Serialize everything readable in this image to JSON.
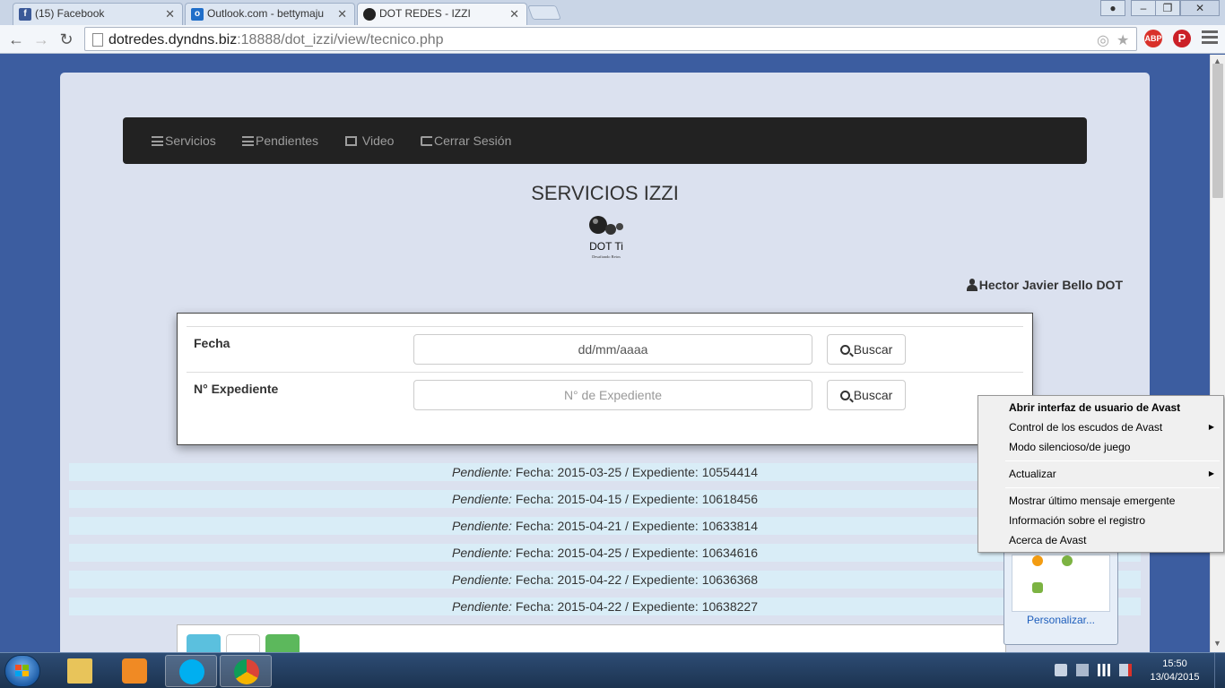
{
  "browser": {
    "tabs": [
      {
        "title": "(15) Facebook",
        "favicon": "facebook-icon",
        "color": "#3b5998"
      },
      {
        "title": "Outlook.com - bettymaju",
        "favicon": "outlook-icon",
        "color": "#1f6ec9"
      },
      {
        "title": "DOT REDES - IZZI",
        "favicon": "dot-logo-icon",
        "color": "#222222",
        "active": true
      }
    ],
    "url_host": "dotredes.dyndns.biz",
    "url_rest": ":18888/dot_izzi/view/tecnico.php",
    "extensions": [
      {
        "label": "ABP",
        "name": "adblock-plus-icon",
        "color": "#d9312a"
      },
      {
        "label": "P",
        "name": "pinterest-icon",
        "color": "#cb2027"
      }
    ]
  },
  "nav": {
    "servicios": "Servicios",
    "pendientes": "Pendientes",
    "video": "Video",
    "cerrar": "Cerrar Sesión"
  },
  "page": {
    "title": "SERVICIOS IZZI",
    "logo_text": "DOT Ti",
    "logo_tagline": "Desafiando Retos",
    "user": "Hector Javier Bello DOT"
  },
  "search": {
    "fecha_label": "Fecha",
    "fecha_placeholder": "dd/mm/aaaa",
    "expediente_label": "N° Expediente",
    "expediente_placeholder": "N° de Expediente",
    "button": "Buscar"
  },
  "pending": {
    "prefix": "Pendiente:",
    "items": [
      {
        "fecha": "2015-03-25",
        "expediente": "10554414"
      },
      {
        "fecha": "2015-04-15",
        "expediente": "10618456"
      },
      {
        "fecha": "2015-04-21",
        "expediente": "10633814"
      },
      {
        "fecha": "2015-04-25",
        "expediente": "10634616"
      },
      {
        "fecha": "2015-04-22",
        "expediente": "10636368"
      },
      {
        "fecha": "2015-04-22",
        "expediente": "10638227"
      }
    ]
  },
  "context_menu": {
    "items": [
      {
        "label": "Abrir interfaz de usuario de Avast",
        "bold": true
      },
      {
        "label": "Control de los escudos de Avast",
        "submenu": true
      },
      {
        "label": "Modo silencioso/de juego"
      },
      {
        "label": "Actualizar",
        "submenu": true
      },
      {
        "label": "Mostrar último mensaje emergente"
      },
      {
        "label": "Información sobre el registro"
      },
      {
        "label": "Acerca de Avast"
      }
    ]
  },
  "tray_popup": {
    "customize": "Personalizar..."
  },
  "taskbar": {
    "time": "15:50",
    "date": "13/04/2015",
    "apps": [
      "explorer-icon",
      "media-player-icon",
      "skype-icon",
      "chrome-icon"
    ]
  }
}
